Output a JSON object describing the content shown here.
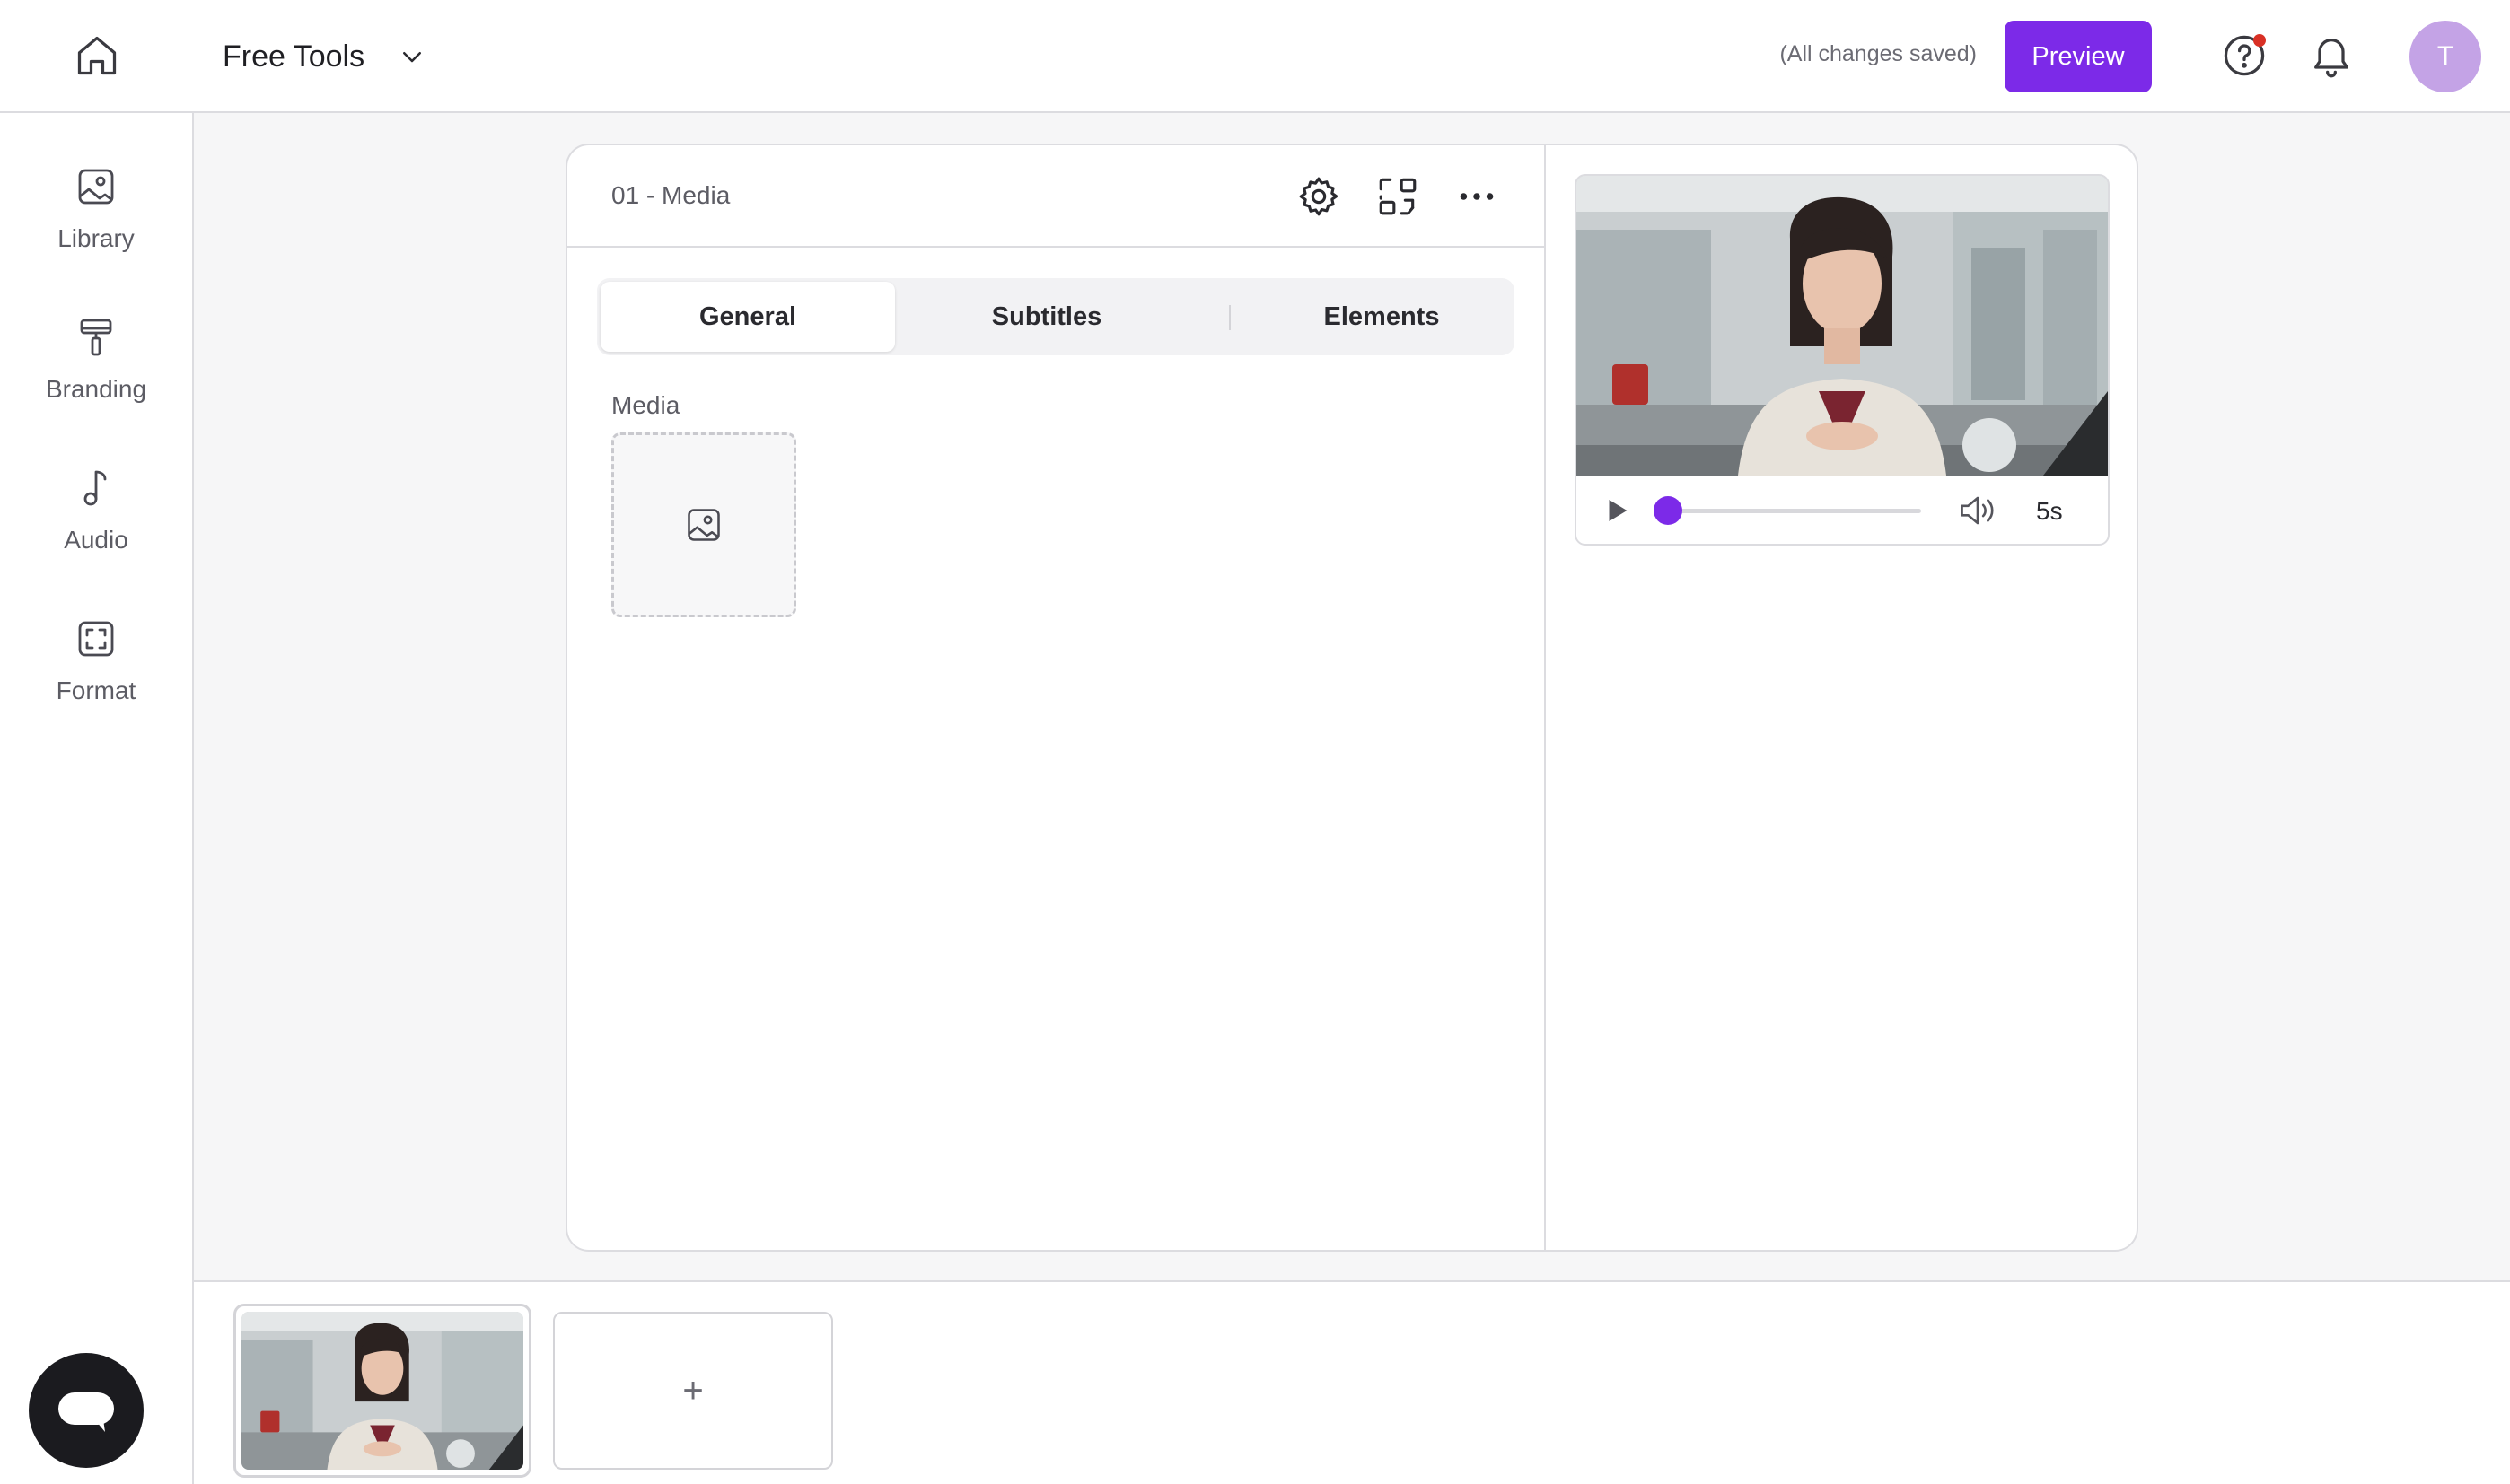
{
  "topbar": {
    "project_name": "Free Tools",
    "save_status": "(All changes saved)",
    "preview_label": "Preview",
    "avatar_initial": "T",
    "icons": [
      "home-icon",
      "chevron-down-icon",
      "help-icon",
      "bell-icon"
    ],
    "help_has_notification": true
  },
  "sidebar": {
    "items": [
      {
        "label": "Library",
        "icon": "image-icon"
      },
      {
        "label": "Branding",
        "icon": "paint-roller-icon"
      },
      {
        "label": "Audio",
        "icon": "music-note-icon"
      },
      {
        "label": "Format",
        "icon": "aspect-ratio-icon"
      }
    ]
  },
  "editor": {
    "scene_title": "01 - Media",
    "header_icons": [
      "gear-icon",
      "swap-layout-icon",
      "more-icon"
    ],
    "tabs": [
      {
        "label": "General",
        "active": true
      },
      {
        "label": "Subtitles",
        "active": false
      },
      {
        "label": "Elements",
        "active": false
      }
    ],
    "media_label": "Media"
  },
  "player": {
    "duration": "5s",
    "progress": 0.04
  },
  "timeline": {
    "add_label": "+"
  },
  "colors": {
    "accent": "#7c2ae8",
    "avatar": "#c4a3e6",
    "notification": "#d93025"
  }
}
